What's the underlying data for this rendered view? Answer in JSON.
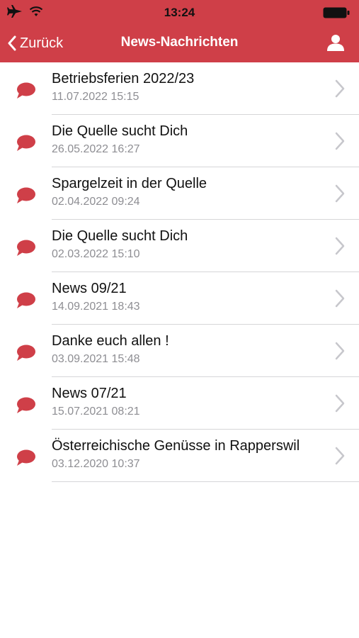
{
  "status_bar": {
    "time": "13:24"
  },
  "nav": {
    "back_label": "Zurück",
    "title": "News-Nachrichten"
  },
  "colors": {
    "accent": "#cf3f48",
    "chevron": "#c7c7cc",
    "subtitle": "#8e8e93"
  },
  "items": [
    {
      "title": "Betriebsferien 2022/23",
      "date": "11.07.2022 15:15"
    },
    {
      "title": "Die Quelle sucht Dich",
      "date": "26.05.2022 16:27"
    },
    {
      "title": "Spargelzeit in der Quelle",
      "date": "02.04.2022 09:24"
    },
    {
      "title": "Die Quelle sucht Dich",
      "date": "02.03.2022 15:10"
    },
    {
      "title": "News 09/21",
      "date": "14.09.2021 18:43"
    },
    {
      "title": "Danke euch allen !",
      "date": "03.09.2021 15:48"
    },
    {
      "title": "News 07/21",
      "date": "15.07.2021 08:21"
    },
    {
      "title": "Österreichische Genüsse in Rapperswil",
      "date": "03.12.2020 10:37"
    }
  ]
}
